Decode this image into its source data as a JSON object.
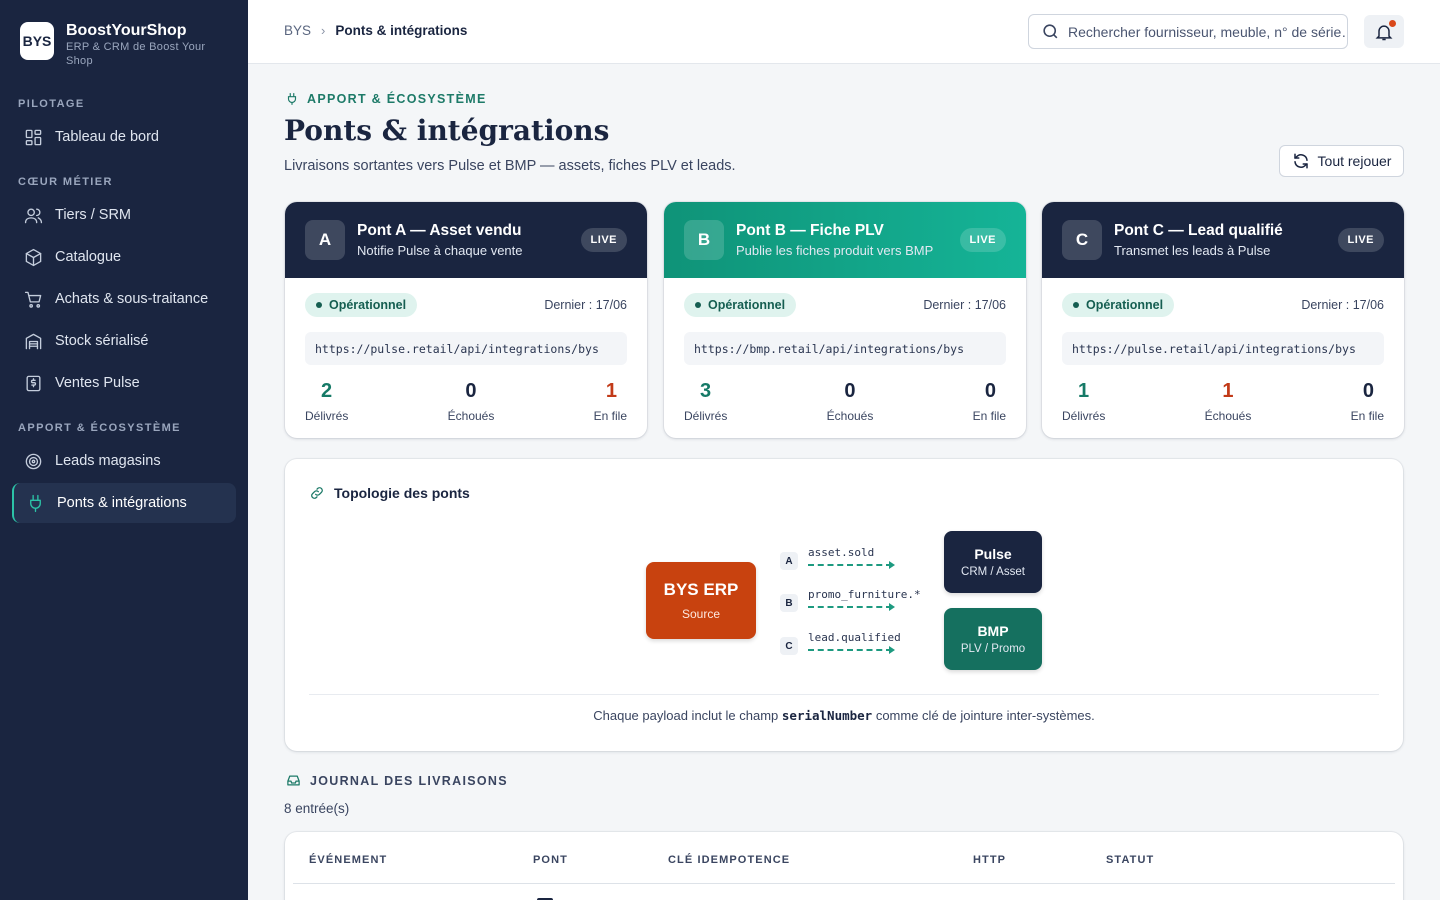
{
  "brand": {
    "logo": "BYS",
    "name": "BoostYourShop",
    "subtitle": "ERP & CRM de Boost Your Shop"
  },
  "nav": {
    "sections": [
      {
        "label": "PILOTAGE",
        "items": [
          {
            "label": "Tableau de bord",
            "icon": "grid-icon"
          }
        ]
      },
      {
        "label": "CŒUR MÉTIER",
        "items": [
          {
            "label": "Tiers / SRM",
            "icon": "users-icon"
          },
          {
            "label": "Catalogue",
            "icon": "box-icon"
          },
          {
            "label": "Achats & sous-traitance",
            "icon": "cart-icon"
          },
          {
            "label": "Stock sérialisé",
            "icon": "warehouse-icon"
          },
          {
            "label": "Ventes Pulse",
            "icon": "receipt-icon"
          }
        ]
      },
      {
        "label": "APPORT & ÉCOSYSTÈME",
        "items": [
          {
            "label": "Leads magasins",
            "icon": "target-icon"
          },
          {
            "label": "Ponts & intégrations",
            "icon": "plug-icon",
            "active": true
          }
        ]
      }
    ]
  },
  "header": {
    "breadcrumb": [
      "BYS",
      "Ponts & intégrations"
    ],
    "search_placeholder": "Rechercher fournisseur, meuble, n° de série…"
  },
  "page": {
    "eyebrow": "APPORT & ÉCOSYSTÈME",
    "title": "Ponts & intégrations",
    "subtitle": "Livraisons sortantes vers Pulse et BMP — assets, fiches PLV et leads.",
    "replay_label": "Tout rejouer"
  },
  "bridges": [
    {
      "letter": "A",
      "title": "Pont A — Asset vendu",
      "subtitle": "Notifie Pulse à chaque vente",
      "badge": "LIVE",
      "theme": "dark",
      "status": "Opérationnel",
      "last": "Dernier : 17/06",
      "url": "https://pulse.retail/api/integrations/bys",
      "stats": [
        {
          "value": "2",
          "label": "Délivrés",
          "tone": "teal"
        },
        {
          "value": "0",
          "label": "Échoués",
          "tone": "neutral"
        },
        {
          "value": "1",
          "label": "En file",
          "tone": "red"
        }
      ]
    },
    {
      "letter": "B",
      "title": "Pont B — Fiche PLV",
      "subtitle": "Publie les fiches produit vers BMP",
      "badge": "LIVE",
      "theme": "teal",
      "status": "Opérationnel",
      "last": "Dernier : 17/06",
      "url": "https://bmp.retail/api/integrations/bys",
      "stats": [
        {
          "value": "3",
          "label": "Délivrés",
          "tone": "teal"
        },
        {
          "value": "0",
          "label": "Échoués",
          "tone": "neutral"
        },
        {
          "value": "0",
          "label": "En file",
          "tone": "neutral"
        }
      ]
    },
    {
      "letter": "C",
      "title": "Pont C — Lead qualifié",
      "subtitle": "Transmet les leads à Pulse",
      "badge": "LIVE",
      "theme": "dark",
      "status": "Opérationnel",
      "last": "Dernier : 17/06",
      "url": "https://pulse.retail/api/integrations/bys",
      "stats": [
        {
          "value": "1",
          "label": "Délivrés",
          "tone": "teal"
        },
        {
          "value": "1",
          "label": "Échoués",
          "tone": "red"
        },
        {
          "value": "0",
          "label": "En file",
          "tone": "neutral"
        }
      ]
    }
  ],
  "topology": {
    "title": "Topologie des ponts",
    "source": {
      "name": "BYS ERP",
      "role": "Source"
    },
    "edges": [
      {
        "tag": "A",
        "event": "asset.sold"
      },
      {
        "tag": "B",
        "event": "promo_furniture.*"
      },
      {
        "tag": "C",
        "event": "lead.qualified"
      }
    ],
    "targets": [
      {
        "name": "Pulse",
        "role": "CRM / Asset"
      },
      {
        "name": "BMP",
        "role": "PLV / Promo"
      }
    ],
    "note_before": "Chaque payload inclut le champ",
    "note_key": "serialNumber",
    "note_after": "comme clé de jointure inter-systèmes."
  },
  "journal": {
    "title": "JOURNAL DES LIVRAISONS",
    "count": "8 entrée(s)",
    "columns": [
      "ÉVÉNEMENT",
      "PONT",
      "CLÉ IDEMPOTENCE",
      "HTTP",
      "STATUT"
    ]
  },
  "colors": {
    "sidebar": "#1a2540",
    "accent": "#15b497",
    "source": "#c8420f",
    "danger": "#c23a18"
  }
}
